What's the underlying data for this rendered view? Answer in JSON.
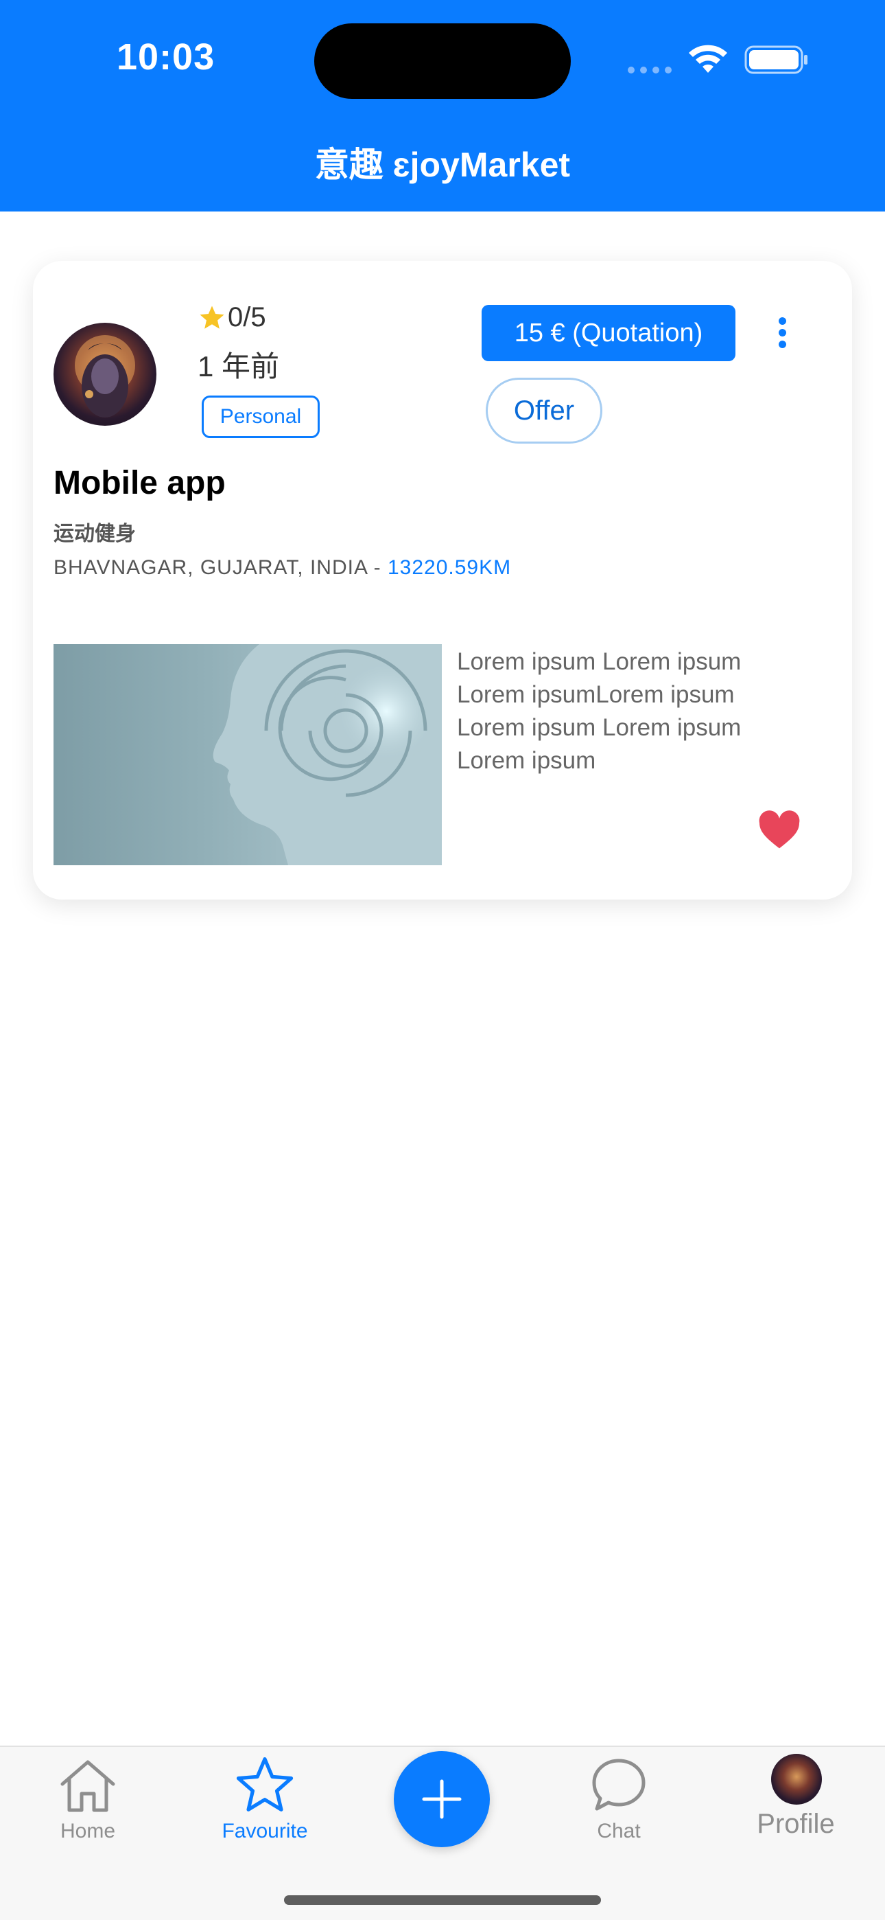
{
  "status_bar": {
    "time": "10:03"
  },
  "header": {
    "title": "意趣 ɛjoyMarket"
  },
  "card": {
    "rating": "0/5",
    "time_ago": "1 年前",
    "tag": "Personal",
    "price_label": "15 € (Quotation)",
    "offer_label": "Offer",
    "title": "Mobile app",
    "category": "运动健身",
    "location": "BHAVNAGAR, GUJARAT, INDIA - ",
    "distance": "13220.59KM",
    "description": "Lorem ipsum Lorem ipsum Lorem ipsumLorem ipsum Lorem ipsum Lorem ipsum Lorem ipsum",
    "favorited": true
  },
  "bottom_nav": {
    "items": [
      {
        "label": "Home",
        "icon": "home-icon",
        "active": false
      },
      {
        "label": "Favourite",
        "icon": "star-icon",
        "active": true
      },
      {
        "label": "Chat",
        "icon": "chat-icon",
        "active": false
      },
      {
        "label": "Profile",
        "icon": "avatar",
        "active": false
      }
    ],
    "add_icon": "plus-icon"
  },
  "colors": {
    "primary": "#0A7CFF",
    "heart": "#E8455A",
    "star": "#F7C325",
    "inactive": "#8E8E8E"
  }
}
